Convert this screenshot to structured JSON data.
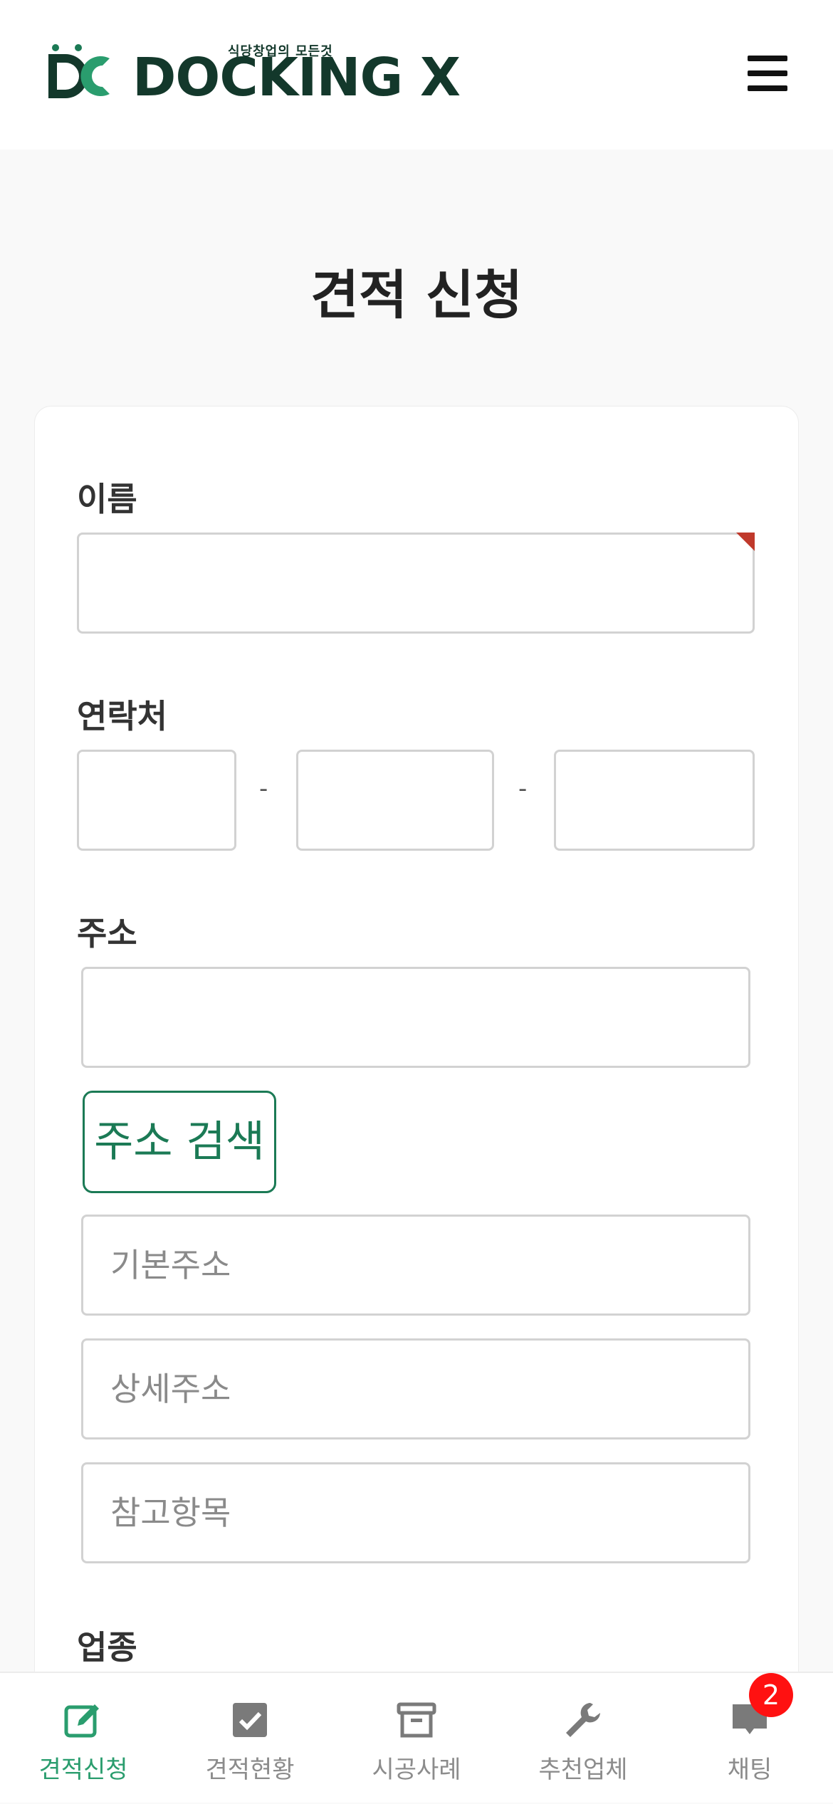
{
  "header": {
    "tagline": "식당창업의 모든것",
    "brand": "DOCKING X",
    "menu_icon": "hamburger-menu-icon"
  },
  "page": {
    "title": "견적 신청"
  },
  "form": {
    "name": {
      "label": "이름",
      "value": ""
    },
    "phone": {
      "label": "연락처",
      "separator": "-",
      "part1": "",
      "part2": "",
      "part3": ""
    },
    "address": {
      "label": "주소",
      "postcode": "",
      "search_button": "주소 검색",
      "basic_placeholder": "기본주소",
      "detail_placeholder": "상세주소",
      "reference_placeholder": "참고항목"
    },
    "business_type": {
      "label": "업종"
    }
  },
  "tabbar": {
    "accent_color": "#2a9d6e",
    "badge_color": "#ff1111",
    "items": [
      {
        "label": "견적신청",
        "icon": "edit-icon",
        "active": true
      },
      {
        "label": "견적현황",
        "icon": "checkbox-icon",
        "active": false
      },
      {
        "label": "시공사례",
        "icon": "archive-box-icon",
        "active": false
      },
      {
        "label": "추천업체",
        "icon": "wrench-icon",
        "active": false
      },
      {
        "label": "채팅",
        "icon": "chat-icon",
        "active": false,
        "badge": "2"
      }
    ]
  }
}
